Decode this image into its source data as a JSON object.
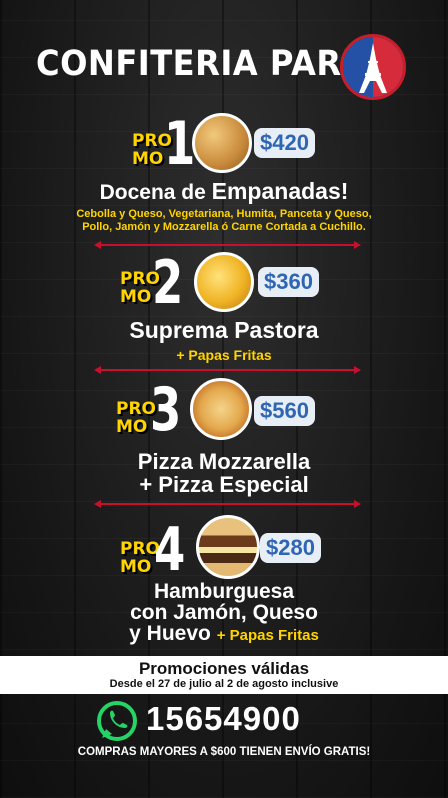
{
  "brand": {
    "name": "CONFITERIA PARIS"
  },
  "promo_word": {
    "line1": "PRO",
    "line2": "MO"
  },
  "promos": [
    {
      "number": "1",
      "price": "$420",
      "title_a": "Docena de ",
      "title_b": "Empanadas!",
      "details_1": "Cebolla y Queso, Vegetariana, Humita, Panceta y Queso,",
      "details_2": "Pollo, Jamón y Mozzarella ó Carne Cortada a Cuchillo."
    },
    {
      "number": "2",
      "price": "$360",
      "title": "Suprema Pastora",
      "extra": "+ Papas Fritas"
    },
    {
      "number": "3",
      "price": "$560",
      "title_1": "Pizza Mozzarella",
      "title_2": "+ Pizza Especial"
    },
    {
      "number": "4",
      "price": "$280",
      "title_1": "Hamburguesa",
      "title_2": "con Jamón, Queso",
      "title_3": "y Huevo",
      "extra": "+ Papas Fritas"
    }
  ],
  "validity": {
    "title": "Promociones válidas",
    "dates": "Desde el 27 de julio al 2 de agosto inclusive"
  },
  "contact": {
    "phone": "15654900",
    "shipping": "COMPRAS MAYORES A $600 TIENEN ENVÍO GRATIS!"
  },
  "icons": {
    "logo": "eiffel-tower-logo",
    "contact": "whatsapp-icon"
  },
  "colors": {
    "accent_yellow": "#ffd400",
    "price_blue": "#2f66b3",
    "divider_red": "#c8102e",
    "logo_blue": "#2450a5"
  }
}
